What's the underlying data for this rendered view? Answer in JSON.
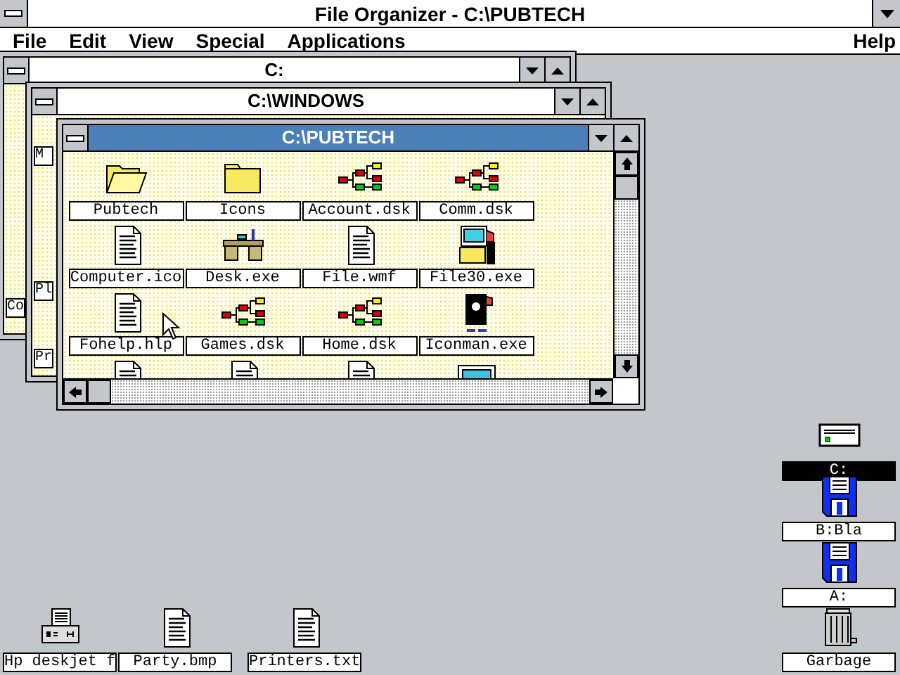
{
  "app": {
    "title": "File Organizer - C:\\PUBTECH",
    "menu": [
      {
        "label": "File"
      },
      {
        "label": "Edit"
      },
      {
        "label": "View"
      },
      {
        "label": "Special"
      },
      {
        "label": "Applications"
      }
    ],
    "help": "Help"
  },
  "windows": [
    {
      "title": "C:",
      "active": false,
      "fragments": [
        "Co"
      ]
    },
    {
      "title": "C:\\WINDOWS",
      "active": false,
      "fragments": [
        "M",
        "Pl",
        "Pr"
      ]
    },
    {
      "title": "C:\\PUBTECH",
      "active": true,
      "items": [
        {
          "kind": "folder-open",
          "label": "Pubtech"
        },
        {
          "kind": "folder",
          "label": "Icons"
        },
        {
          "kind": "diagram",
          "label": "Account.dsk"
        },
        {
          "kind": "diagram",
          "label": "Comm.dsk"
        },
        {
          "kind": "document",
          "label": "Computer.ico"
        },
        {
          "kind": "desk",
          "label": "Desk.exe"
        },
        {
          "kind": "document",
          "label": "File.wmf"
        },
        {
          "kind": "app",
          "label": "File30.exe"
        },
        {
          "kind": "document",
          "label": "Fohelp.hlp"
        },
        {
          "kind": "diagram",
          "label": "Games.dsk"
        },
        {
          "kind": "diagram",
          "label": "Home.dsk"
        },
        {
          "kind": "iconman",
          "label": "Iconman.exe"
        },
        {
          "kind": "document"
        },
        {
          "kind": "document"
        },
        {
          "kind": "document"
        },
        {
          "kind": "computer"
        }
      ]
    }
  ],
  "desktop_icons": [
    {
      "kind": "drive",
      "label": "C:",
      "selected": true
    },
    {
      "kind": "floppy",
      "label": "B:Bla",
      "selected": false
    },
    {
      "kind": "floppy",
      "label": "A:",
      "selected": false
    },
    {
      "kind": "printer",
      "label": "Hp deskjet f",
      "selected": false
    },
    {
      "kind": "document",
      "label": "Party.bmp",
      "selected": false
    },
    {
      "kind": "document",
      "label": "Printers.txt",
      "selected": false
    },
    {
      "kind": "trash",
      "label": "Garbage",
      "selected": false
    }
  ]
}
